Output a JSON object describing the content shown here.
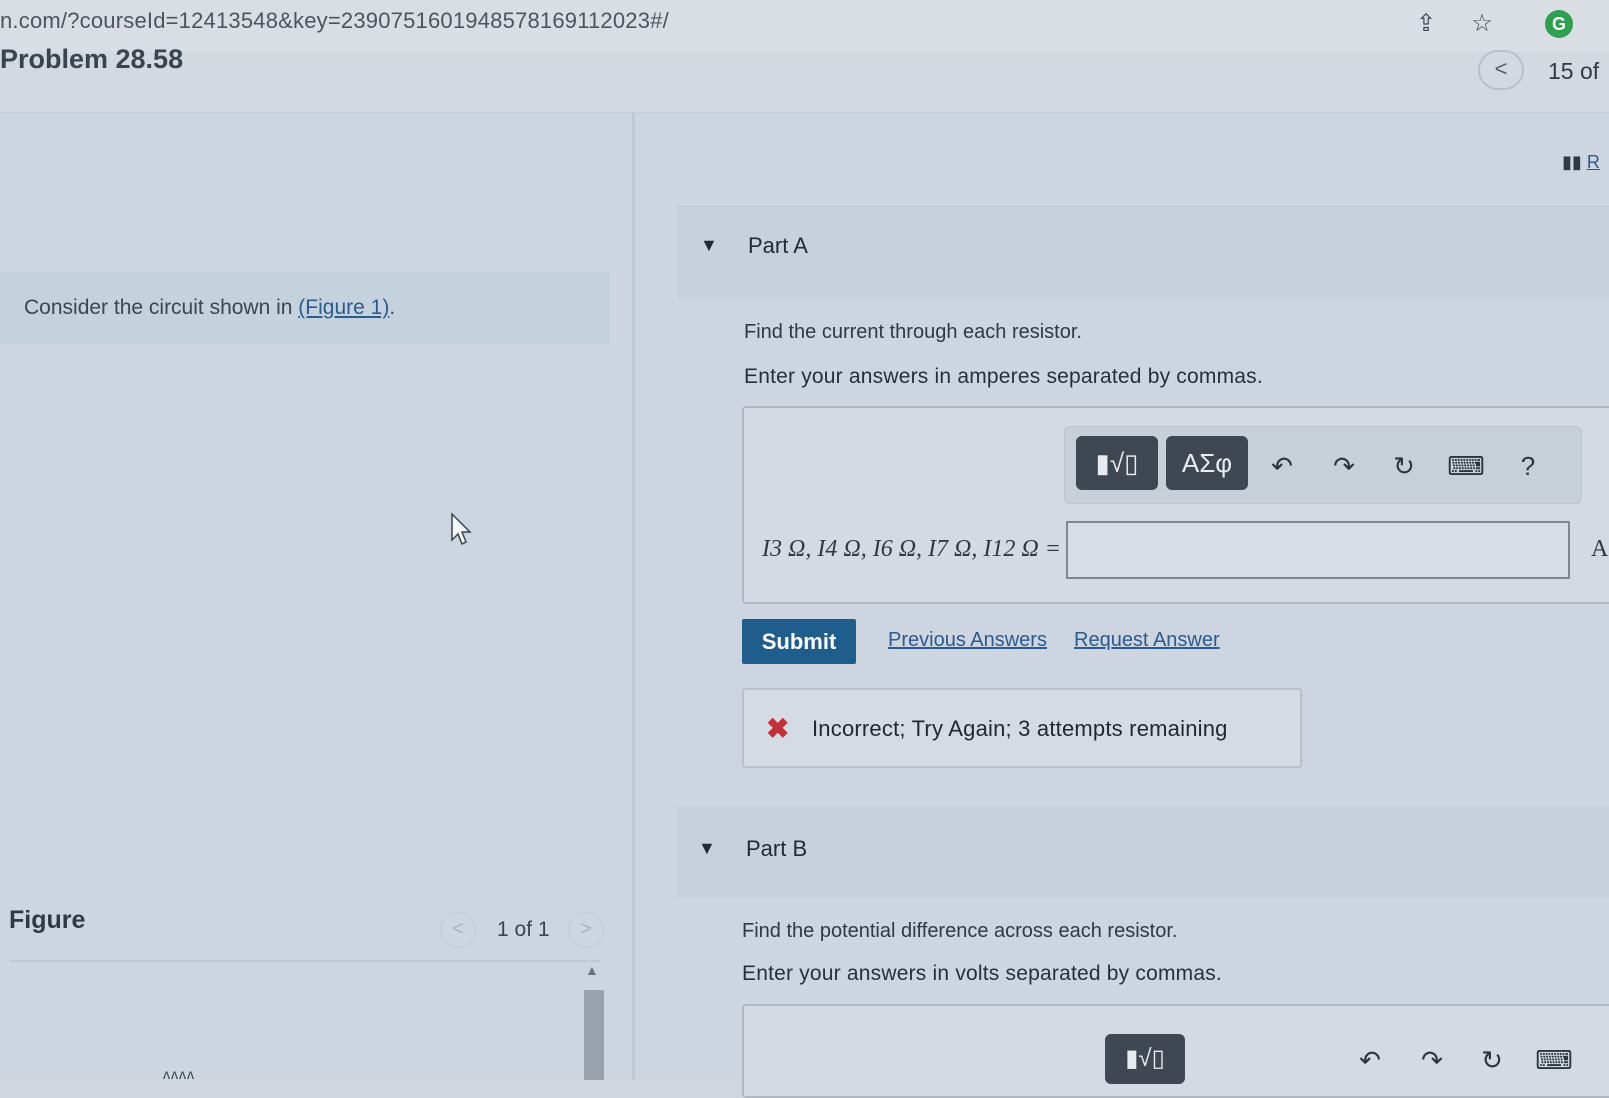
{
  "browser": {
    "url": "n.com/?courseId=12413548&key=239075160194857816911202​3#/",
    "icons": [
      "share-icon",
      "star-icon",
      "extension-g-icon"
    ]
  },
  "problem": {
    "title": "Problem 28.58",
    "page_nav_prev": "<",
    "page_count": "15 of"
  },
  "left": {
    "intro_prefix": "Consider the circuit shown in ",
    "intro_link": "(Figure 1)",
    "intro_suffix": ".",
    "figure_label": "Figure",
    "figure_prev": "<",
    "figure_next": ">",
    "figure_count": "1 of 1"
  },
  "right": {
    "review_label": "R",
    "partA": {
      "label": "Part A",
      "question": "Find the current through each resistor.",
      "instruction": "Enter your answers in amperes separated by commas.",
      "toolbar": {
        "templates_label": "▮√▯",
        "symbols_label": "ΑΣφ",
        "undo": "↶",
        "redo": "↷",
        "reset": "↻",
        "keyboard": "⌨",
        "help": "?"
      },
      "math_label": "I3 Ω, I4 Ω, I6 Ω, I7 Ω, I12 Ω =",
      "input_value": "",
      "unit": "A",
      "submit": "Submit",
      "previous_answers": "Previous Answers",
      "request_answer": "Request Answer",
      "feedback": "Incorrect; Try Again; 3 attempts remaining"
    },
    "partB": {
      "label": "Part B",
      "question": "Find the potential difference across each resistor.",
      "instruction": "Enter your answers in volts separated by commas.",
      "toolbar": {
        "templates_label": "▮√▯",
        "undo": "↶",
        "redo": "↷",
        "reset": "↻",
        "keyboard": "⌨"
      }
    }
  },
  "colors": {
    "submit_bg": "#1f5d8d",
    "link": "#2b5a8f",
    "error": "#c0323a"
  }
}
